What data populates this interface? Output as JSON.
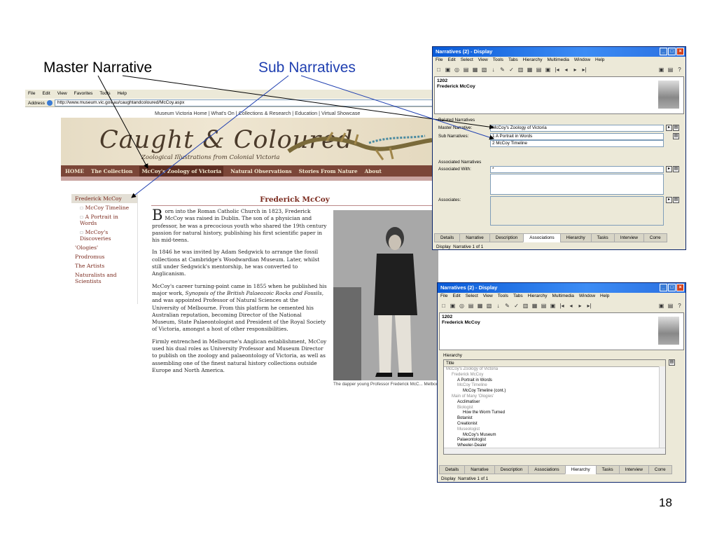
{
  "callouts": {
    "master": "Master Narrative",
    "sub": "Sub Narratives",
    "colors": {
      "master": "#000000",
      "sub": "#1f3fb0"
    }
  },
  "slide_number": "18",
  "browser": {
    "menu": [
      "File",
      "Edit",
      "View",
      "Favorites",
      "Tools",
      "Help"
    ],
    "address_label": "Address",
    "url": "http://www.museum.vic.gov.au/caughtandcoloured/McCoy.aspx",
    "top_nav": "Museum Victoria Home  |  What's On  |  Collections & Research  |  Education  |  Virtual Showcase",
    "banner_title": "Caught & Coloured",
    "banner_subtitle": "Zoological Illustrations from Colonial Victoria",
    "nav": [
      "HOME",
      "The Collection",
      "McCoy's Zoology of Victoria",
      "Natural Observations",
      "Stories From Nature",
      "About"
    ],
    "left_nav": {
      "item1": "Frederick McCoy",
      "sub1": "McCoy Timeline",
      "sub2": "A Portrait in Words",
      "sub3": "McCoy's Discoveries",
      "item2": "'Ologies'",
      "item3": "Prodromus",
      "item4": "The Artists",
      "item5": "Naturalists and Scientists"
    },
    "article": {
      "title": "Frederick McCoy",
      "dropcap": "B",
      "p1": "orn into the Roman Catholic Church in 1823, Frederick McCoy was raised in Dublin. The son of a physician and professor, he was a precocious youth who shared the 19th century passion for natural history, publishing his first scientific paper in his mid-teens.",
      "p2": "In 1846 he was invited by Adam Sedgwick to arrange the fossil collections at Cambridge's Woodwardian Museum. Later, whilst still under Sedgwick's mentorship, he was converted to Anglicanism.",
      "p3a": "McCoy's career turning-point came in 1855 when he published his major work, ",
      "p3b": "Synopsis of the British Palaeozoic Rocks and Fossils",
      "p3c": ", and was appointed Professor of Natural Sciences at the University of Melbourne. From this platform he cemented his Australian reputation, becoming Director of the National Museum, State Palaeontologist and President of the Royal Society of Victoria, amongst a host of other responsibilities.",
      "p4": "Firmly entrenched in Melbourne's Anglican establishment, McCoy used his dual roles as University Professor and Museum Director to publish on the zoology and palaeontology of Victoria, as well as assembling one of the finest natural history collections outside Europe and North America."
    },
    "photo_caption": "The dapper young Professor Frederick McC... Melbourne University."
  },
  "app": {
    "title": "Narratives (2) - Display",
    "menu": [
      "File",
      "Edit",
      "Select",
      "View",
      "Tools",
      "Tabs",
      "Hierarchy",
      "Multimedia",
      "Window",
      "Help"
    ],
    "record_id": "1202",
    "record_name": "Frederick McCoy",
    "tabs": [
      "Details",
      "Narrative",
      "Description",
      "Associations",
      "Hierarchy",
      "Tasks",
      "Interview",
      "Corre"
    ],
    "status_mode": "Display",
    "status_record": "Narrative 1 of 1"
  },
  "window1": {
    "active_tab": "Associations",
    "related_group": "Related Narratives",
    "master_label": "Master Narrative:",
    "master_value": "McCoy's Zoology of Victoria",
    "sub_label": "Sub Narratives:",
    "sub_rows": [
      {
        "num": "1",
        "value": "A Portrait in Words"
      },
      {
        "num": "2",
        "value": "McCoy Timeline"
      }
    ],
    "assoc_group": "Associated Narratives",
    "assoc_with_label": "Associated With:",
    "assoc_with_marker": "*",
    "associates_label": "Associates:"
  },
  "window2": {
    "active_tab": "Hierarchy",
    "group": "Hierarchy",
    "column": "Title",
    "rows": [
      {
        "text": "McCoy's Zoology of Victoria",
        "indent": 0,
        "gray": true
      },
      {
        "text": "Frederick McCoy",
        "indent": 1,
        "gray": true
      },
      {
        "text": "A Portrait in Words",
        "indent": 2,
        "gray": false
      },
      {
        "text": "McCoy Timeline",
        "indent": 2,
        "gray": true
      },
      {
        "text": "McCoy Timeline (cont.)",
        "indent": 3,
        "gray": false
      },
      {
        "text": "Main of Many 'Ologies'",
        "indent": 1,
        "gray": true
      },
      {
        "text": "Acclimatiser",
        "indent": 2,
        "gray": false
      },
      {
        "text": "Biologist",
        "indent": 2,
        "gray": true
      },
      {
        "text": "How the Worm Turned",
        "indent": 3,
        "gray": false
      },
      {
        "text": "Botanist",
        "indent": 2,
        "gray": false
      },
      {
        "text": "Creationist",
        "indent": 2,
        "gray": false
      },
      {
        "text": "Museologist",
        "indent": 2,
        "gray": true
      },
      {
        "text": "McCoy's Museum",
        "indent": 3,
        "gray": false
      },
      {
        "text": "Palaeontologist",
        "indent": 2,
        "gray": false
      },
      {
        "text": "Wheeler-Dealer",
        "indent": 2,
        "gray": false
      }
    ]
  }
}
